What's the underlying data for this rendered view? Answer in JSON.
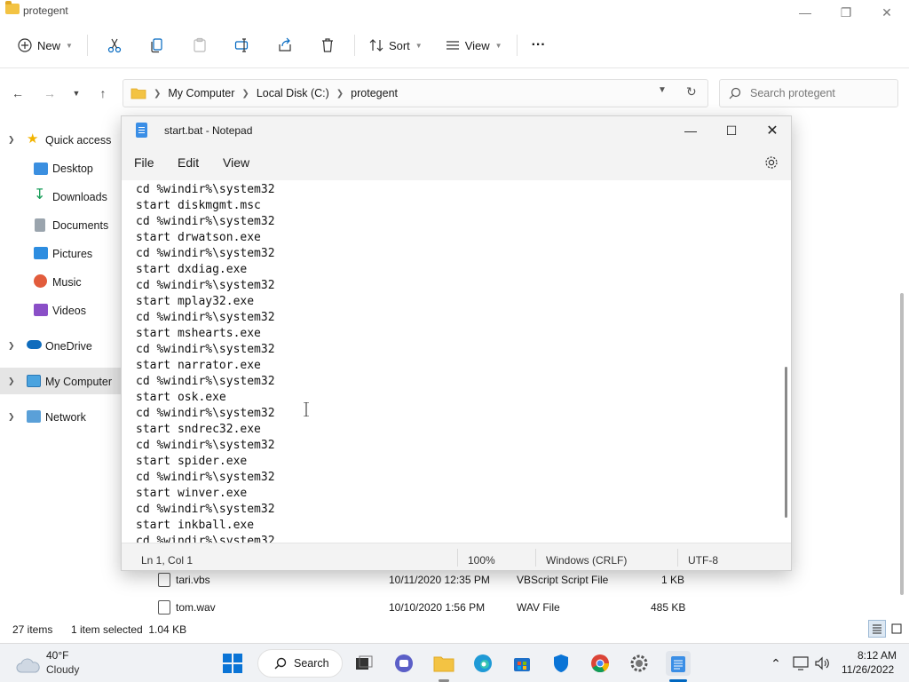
{
  "explorer": {
    "title": "protegent",
    "toolbar": {
      "new_label": "New",
      "sort_label": "Sort",
      "view_label": "View",
      "more_label": "···"
    },
    "breadcrumb": [
      "My Computer",
      "Local Disk (C:)",
      "protegent"
    ],
    "search_placeholder": "Search protegent",
    "sidebar": {
      "quick_access": "Quick access",
      "desktop": "Desktop",
      "downloads": "Downloads",
      "documents": "Documents",
      "pictures": "Pictures",
      "music": "Music",
      "videos": "Videos",
      "onedrive": "OneDrive",
      "my_computer": "My Computer",
      "network": "Network"
    },
    "files": [
      {
        "name": "tari.vbs",
        "date": "10/11/2020 12:35 PM",
        "type": "VBScript Script File",
        "size": "1 KB"
      },
      {
        "name": "tom.wav",
        "date": "10/10/2020 1:56 PM",
        "type": "WAV File",
        "size": "485 KB"
      }
    ],
    "status": {
      "items": "27 items",
      "selected": "1 item selected  1.04 KB"
    }
  },
  "notepad": {
    "title": "start.bat - Notepad",
    "menu": [
      "File",
      "Edit",
      "View"
    ],
    "lines": [
      "cd %windir%\\system32",
      "start diskmgmt.msc",
      "cd %windir%\\system32",
      "start drwatson.exe",
      "cd %windir%\\system32",
      "start dxdiag.exe",
      "cd %windir%\\system32",
      "start mplay32.exe",
      "cd %windir%\\system32",
      "start mshearts.exe",
      "cd %windir%\\system32",
      "start narrator.exe",
      "cd %windir%\\system32",
      "start osk.exe",
      "cd %windir%\\system32",
      "start sndrec32.exe",
      "cd %windir%\\system32",
      "start spider.exe",
      "cd %windir%\\system32",
      "start winver.exe",
      "cd %windir%\\system32",
      "start inkball.exe",
      "cd %windir%\\system32"
    ],
    "status": {
      "position": "Ln 1, Col 1",
      "zoom": "100%",
      "line_ending": "Windows (CRLF)",
      "encoding": "UTF-8"
    }
  },
  "taskbar": {
    "weather_temp": "40°F",
    "weather_condition": "Cloudy",
    "search_label": "Search",
    "time": "8:12 AM",
    "date": "11/26/2022"
  },
  "colors": {
    "accent": "#0067c0",
    "folder": "#f3c343",
    "selection": "#e5e5e5"
  }
}
